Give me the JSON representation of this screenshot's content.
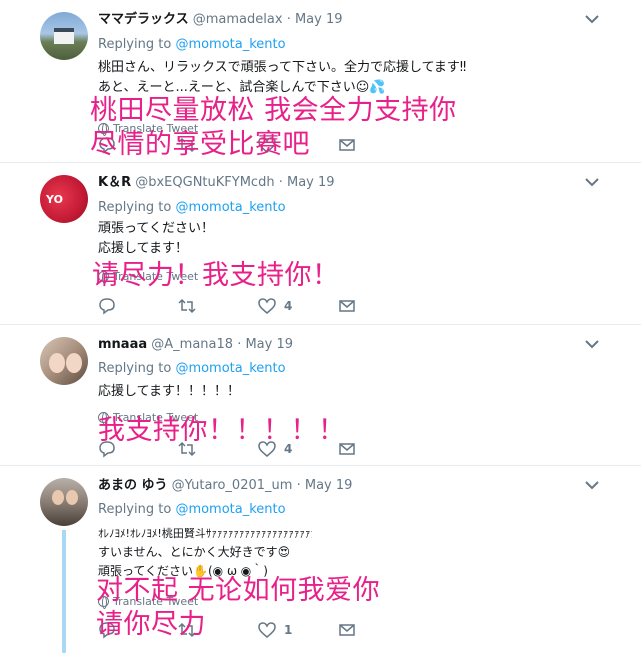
{
  "tweets": [
    {
      "name": "ママデラックス",
      "handle": "@mamadelax",
      "sep": "·",
      "date": "May 19",
      "replying_to_label": "Replying to",
      "replying_to_mention": "@momota_kento",
      "lines": [
        "桃田さん、リラックスで頑張って下さい。全力で応援してます‼",
        "あと、えーと...えーと、試合楽しんで下さい☺💦"
      ],
      "translate": "Translate Tweet",
      "overlay": [
        "桃田尽量放松 我会全力支持你",
        "尽情的享受比赛吧"
      ],
      "likes": ""
    },
    {
      "name": "K＆R",
      "handle": "@bxEQGNtuKFYMcdh",
      "sep": "·",
      "date": "May 19",
      "replying_to_label": "Replying to",
      "replying_to_mention": "@momota_kento",
      "lines": [
        "頑張ってください！",
        "応援してます！"
      ],
      "translate": "Translate Tweet",
      "overlay": [
        "请尽力！我支持你！"
      ],
      "likes": "4",
      "avatar_text": "YO"
    },
    {
      "name": "mnaaa",
      "handle": "@A_mana18",
      "sep": "·",
      "date": "May 19",
      "replying_to_label": "Replying to",
      "replying_to_mention": "@momota_kento",
      "lines": [
        "応援してます！！！！！"
      ],
      "translate": "Translate Tweet",
      "overlay": [
        "我支持你！！！！！"
      ],
      "likes": "4"
    },
    {
      "name": "あまの ゆう",
      "handle": "@Yutaro_0201_um",
      "sep": "·",
      "date": "May 19",
      "replying_to_label": "Replying to",
      "replying_to_mention": "@momota_kento",
      "lines": [
        "ｵﾚﾉﾖﾒ!ｵﾚﾉﾖﾒ!桃田賢斗ｻｧｧｧｧｧｧｧｧｧｧｧｧｧｧｧｧｧｧｧｧｧｧｧｧｧｧｧｧｧｧｧｧｧｧｧｧｧｧｧｧｧｧｧｧｧｧ!!!!!!!!",
        "すいません、とにかく大好きです😍",
        "頑張ってください✋(◉ ω ◉｀)"
      ],
      "translate": "Translate Tweet",
      "overlay": [
        "对不起 无论如何我爱你",
        "请你尽力"
      ],
      "likes": "1"
    }
  ],
  "icons": {
    "caret": "chevron-down-icon",
    "reply": "reply-icon",
    "retweet": "retweet-icon",
    "like": "heart-icon",
    "dm": "envelope-icon",
    "translate": "globe-icon"
  },
  "colors": {
    "link": "#1da1f2",
    "muted": "#657786",
    "overlay": "#e8208a",
    "thread": "#a9d8f5"
  }
}
